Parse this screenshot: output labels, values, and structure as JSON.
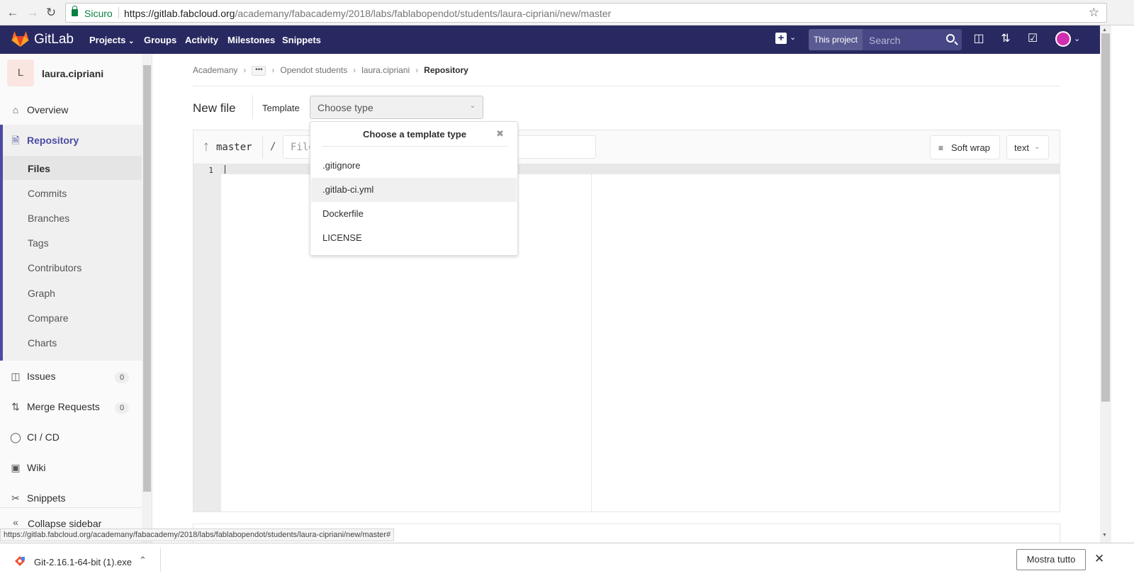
{
  "browser": {
    "secure_label": "Sicuro",
    "url_host": "https://gitlab.fabcloud.org",
    "url_path": "/academany/fabacademy/2018/labs/fablabopendot/students/laura-cipriani/new/master"
  },
  "header": {
    "brand": "GitLab",
    "nav": [
      "Projects",
      "Groups",
      "Activity",
      "Milestones",
      "Snippets"
    ],
    "search_scope": "This project",
    "search_placeholder": "Search"
  },
  "sidebar": {
    "avatar_letter": "L",
    "project_name": "laura.cipriani",
    "overview": "Overview",
    "repository": "Repository",
    "repo_items": [
      "Files",
      "Commits",
      "Branches",
      "Tags",
      "Contributors",
      "Graph",
      "Compare",
      "Charts"
    ],
    "issues": "Issues",
    "issues_count": "0",
    "merge_requests": "Merge Requests",
    "mr_count": "0",
    "cicd": "CI / CD",
    "wiki": "Wiki",
    "snippets": "Snippets",
    "collapse": "Collapse sidebar"
  },
  "breadcrumb": {
    "items": [
      "Academany",
      "Opendot students",
      "laura.cipriani"
    ],
    "current": "Repository"
  },
  "editor": {
    "title": "New file",
    "template_label": "Template",
    "template_value": "Choose type",
    "branch": "master",
    "slash": "/",
    "filename_placeholder": "File",
    "soft_wrap": "Soft wrap",
    "mode": "text",
    "line_number": "1"
  },
  "dropdown": {
    "title": "Choose a template type",
    "items": [
      ".gitignore",
      ".gitlab-ci.yml",
      "Dockerfile",
      "LICENSE"
    ],
    "highlighted": ".gitlab-ci.yml"
  },
  "status_url": "https://gitlab.fabcloud.org/academany/fabacademy/2018/labs/fablabopendot/students/laura-cipriani/new/master#",
  "downloads": {
    "file": "Git-2.16.1-64-bit (1).exe",
    "show_all": "Mostra tutto"
  },
  "colors": {
    "header_bg": "#292961",
    "sidebar_active_border": "#4b4ba3",
    "secure_green": "#0b8043"
  }
}
